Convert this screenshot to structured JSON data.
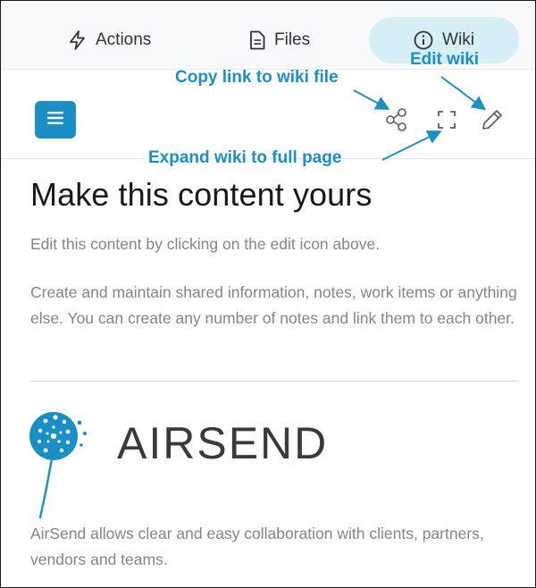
{
  "tabs": [
    {
      "label": "Actions",
      "icon": "lightning-icon"
    },
    {
      "label": "Files",
      "icon": "document-icon"
    },
    {
      "label": "Wiki",
      "icon": "info-icon",
      "active": true
    }
  ],
  "callouts": {
    "copy_link": "Copy link to wiki file",
    "edit_wiki": "Edit wiki",
    "expand": "Expand wiki to full page"
  },
  "toolbar": {
    "menu_icon": "hamburger-icon",
    "share_icon": "share-icon",
    "expand_icon": "expand-icon",
    "edit_icon": "pencil-icon"
  },
  "content": {
    "title": "Make this content yours",
    "para1": "Edit this content by clicking on the edit icon above.",
    "para2": "Create and maintain shared information, notes, work items or anything else. You can create any number of notes and link them to each other.",
    "logo_text": "AIRSEND",
    "para3": "AirSend allows clear and easy collaboration with clients, partners, vendors and teams."
  },
  "colors": {
    "accent": "#1b8ec4",
    "callout": "#1d8fc4",
    "wiki_tab_bg": "#d6eef6",
    "muted_text": "#80868c"
  }
}
